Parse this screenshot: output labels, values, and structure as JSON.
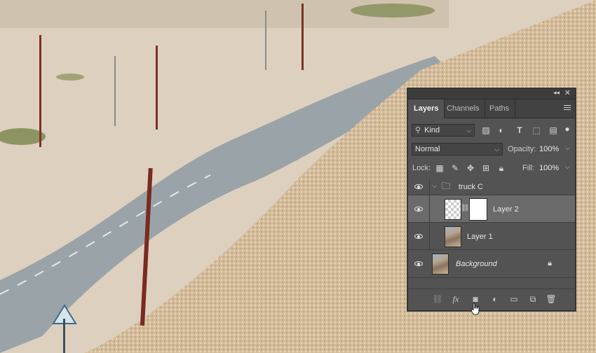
{
  "panel": {
    "tabs": [
      "Layers",
      "Channels",
      "Paths"
    ],
    "active_tab": "Layers",
    "filter": {
      "value": "Kind"
    },
    "blend_mode": {
      "value": "Normal"
    },
    "opacity": {
      "label": "Opacity:",
      "value": "100%"
    },
    "lock": {
      "label": "Lock:"
    },
    "fill": {
      "label": "Fill:",
      "value": "100%"
    },
    "layers": [
      {
        "name": "truck C",
        "type": "group"
      },
      {
        "name": "Layer 2",
        "type": "layer-with-mask",
        "selected": true
      },
      {
        "name": "Layer 1",
        "type": "photo"
      },
      {
        "name": "Background",
        "type": "background",
        "locked": true
      }
    ],
    "bottom_icons": [
      "link-icon",
      "fx-icon",
      "add-mask-icon",
      "adjustment-icon",
      "new-group-icon",
      "new-layer-icon",
      "trash-icon"
    ]
  }
}
